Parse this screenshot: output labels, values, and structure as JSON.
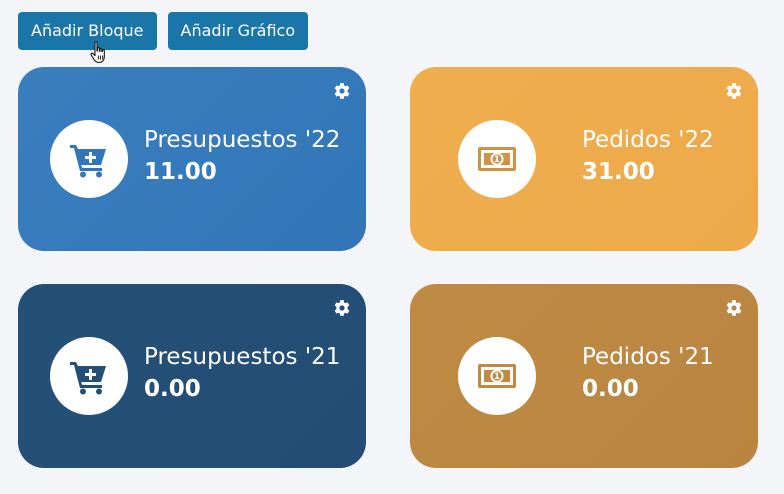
{
  "toolbar": {
    "add_block_label": "Añadir Bloque",
    "add_chart_label": "Añadir Gráfico",
    "button_color": "#1a76a8"
  },
  "cards": [
    {
      "title": "Presupuestos '22",
      "value": "11.00",
      "icon": "cart-plus-icon",
      "color": "#3a7ebf",
      "color_end": "#3176b8",
      "icon_color": "#3176b8"
    },
    {
      "title": "Pedidos '22",
      "value": "31.00",
      "icon": "money-bill-icon",
      "color": "#f0ae4e",
      "color_end": "#eda94a",
      "icon_color": "#cf9347"
    },
    {
      "title": "Presupuestos '21",
      "value": "0.00",
      "icon": "cart-plus-icon",
      "color": "#245078",
      "color_end": "#234d74",
      "icon_color": "#245078"
    },
    {
      "title": "Pedidos '21",
      "value": "0.00",
      "icon": "money-bill-icon",
      "color": "#bf8a44",
      "color_end": "#b98540",
      "icon_color": "#c08a44"
    }
  ]
}
